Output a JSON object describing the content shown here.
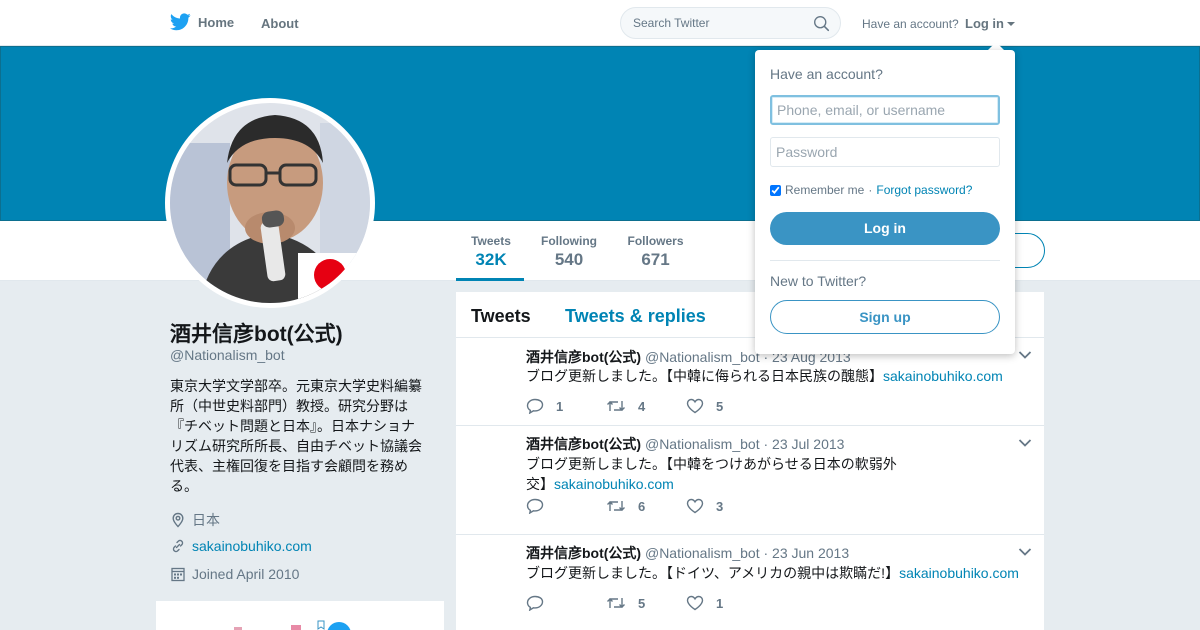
{
  "nav": {
    "home_label": "Home",
    "about_label": "About",
    "search_placeholder": "Search Twitter",
    "have_account": "Have an account?",
    "login_label": "Log in"
  },
  "colors": {
    "brand_blue": "#0084b4",
    "twitter_bird": "#1da1f2",
    "banner": "#0084b4",
    "button_blue": "#3a94c4"
  },
  "stats": [
    {
      "label": "Tweets",
      "value": "32K",
      "active": true
    },
    {
      "label": "Following",
      "value": "540",
      "active": false
    },
    {
      "label": "Followers",
      "value": "671",
      "active": false
    }
  ],
  "profile": {
    "name": "酒井信彦bot(公式)",
    "handle": "@Nationalism_bot",
    "bio": "東京大学文学部卒。元東京大学史料編纂所（中世史料部門）教授。研究分野は『チベット問題と日本』。日本ナショナリズム研究所所長、自由チベット協議会代表、主権回復を目指す会顧問を務める。",
    "location": "日本",
    "website": "sakainobuhiko.com",
    "joined": "Joined April 2010"
  },
  "timeline": {
    "tab_tweets": "Tweets",
    "tab_replies": "Tweets & replies",
    "tweets": [
      {
        "name": "酒井信彦bot(公式)",
        "handle": "@Nationalism_bot",
        "date": "· 23 Aug 2013",
        "text": "ブログ更新しました。【中韓に侮られる日本民族の醜態】",
        "link": "sakainobuhiko.com",
        "replies": "1",
        "retweets": "4",
        "likes": "5"
      },
      {
        "name": "酒井信彦bot(公式)",
        "handle": "@Nationalism_bot",
        "date": "· 23 Jul 2013",
        "text": "ブログ更新しました。【中韓をつけあがらせる日本の軟弱外交】",
        "link": "sakainobuhiko.com",
        "replies": "",
        "retweets": "6",
        "likes": "3"
      },
      {
        "name": "酒井信彦bot(公式)",
        "handle": "@Nationalism_bot",
        "date": "· 23 Jun 2013",
        "text": "ブログ更新しました。【ドイツ、アメリカの親中は欺瞞だ!】",
        "link": "sakainobuhiko.com",
        "replies": "",
        "retweets": "5",
        "likes": "1"
      }
    ]
  },
  "login_dropdown": {
    "title": "Have an account?",
    "username_placeholder": "Phone, email, or username",
    "password_placeholder": "Password",
    "remember_me": "Remember me",
    "separator": "·",
    "forgot_password": "Forgot password?",
    "login_button": "Log in",
    "new_to_twitter": "New to Twitter?",
    "signup_button": "Sign up"
  }
}
